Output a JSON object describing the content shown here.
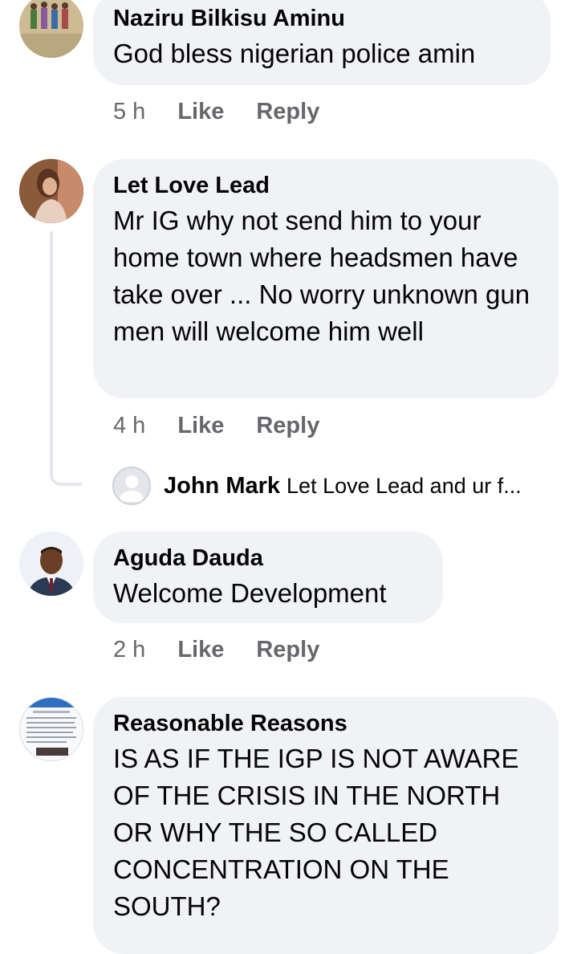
{
  "comments": [
    {
      "author": "Naziru Bilkisu Aminu",
      "text": "God bless nigerian police amin",
      "time": "5 h",
      "like_label": "Like",
      "reply_label": "Reply"
    },
    {
      "author": "Let Love Lead",
      "text": "Mr IG why not send him to your home town where headsmen have take over ... No worry unknown gun men will welcome him well",
      "time": "4 h",
      "like_label": "Like",
      "reply_label": "Reply"
    },
    {
      "author": "Aguda Dauda",
      "text": "Welcome Development",
      "time": "2 h",
      "like_label": "Like",
      "reply_label": "Reply"
    },
    {
      "author": "Reasonable Reasons",
      "text": "IS AS IF THE IGP IS NOT AWARE OF THE CRISIS IN THE NORTH OR WHY THE SO CALLED CONCENTRATION ON THE SOUTH?"
    }
  ],
  "reply_preview": {
    "author": "John Mark",
    "text": "Let Love Lead and ur f..."
  }
}
